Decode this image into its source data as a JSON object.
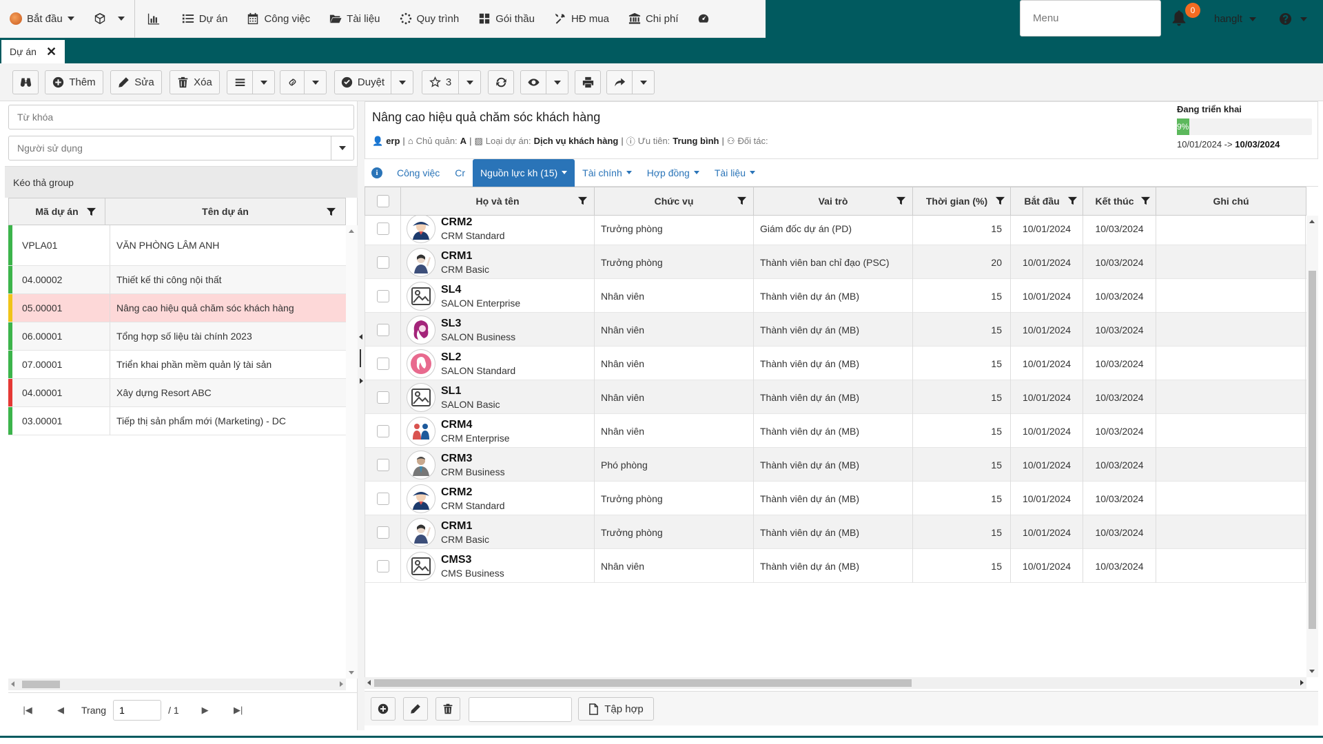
{
  "nav": {
    "start_label": "Bắt đầu",
    "items": [
      {
        "label": "Dự án",
        "icon": "list-icon"
      },
      {
        "label": "Công việc",
        "icon": "calendar-icon"
      },
      {
        "label": "Tài liệu",
        "icon": "folder-icon"
      },
      {
        "label": "Quy trình",
        "icon": "spinner-icon"
      },
      {
        "label": "Gói thầu",
        "icon": "grid-icon"
      },
      {
        "label": "HĐ mua",
        "icon": "tools-icon"
      },
      {
        "label": "Chi phí",
        "icon": "bank-icon"
      }
    ],
    "menu_placeholder": "Menu",
    "notification_count": "0",
    "username": "hanglt",
    "colors": {
      "header": "#015a5f",
      "accent": "#2a74b8",
      "badge": "#f36b21"
    }
  },
  "page_tab": {
    "label": "Dự án",
    "close_icon": "close-icon"
  },
  "toolbar": {
    "add_label": "Thêm",
    "edit_label": "Sửa",
    "delete_label": "Xóa",
    "approve_label": "Duyệt",
    "star_count": "3"
  },
  "left": {
    "keyword_placeholder": "Từ khóa",
    "user_placeholder": "Người sử dụng",
    "group_hint": "Kéo thả group",
    "col_code": "Mã dự án",
    "col_name": "Tên dự án",
    "rows": [
      {
        "code": "VPLA01",
        "name": "VĂN PHÒNG LÂM ANH",
        "status_color": "#3cb44b"
      },
      {
        "code": "04.00002",
        "name": "Thiết kế thi công nội thất",
        "status_color": "#3cb44b"
      },
      {
        "code": "05.00001",
        "name": "Nâng cao hiệu quả chăm sóc khách hàng",
        "status_color": "#f0c419"
      },
      {
        "code": "06.00001",
        "name": "Tổng hợp số liệu tài chính 2023",
        "status_color": "#3cb44b"
      },
      {
        "code": "07.00001",
        "name": "Triển khai phần mềm quản lý tài sản",
        "status_color": "#3cb44b"
      },
      {
        "code": "04.00001",
        "name": "Xây dựng Resort ABC",
        "status_color": "#e53935"
      },
      {
        "code": "03.00001",
        "name": "Tiếp thị sản phẩm mới (Marketing) - DC",
        "status_color": "#3cb44b"
      }
    ],
    "pager": {
      "page_label": "Trang",
      "page_value": "1",
      "total": "/ 1"
    }
  },
  "project": {
    "title": "Nâng cao hiệu quả chăm sóc khách hàng",
    "owner": "erp",
    "manager_label": "Chủ quản:",
    "manager": "A",
    "type_label": "Loại dự án:",
    "type": "Dịch vụ khách hàng",
    "priority_label": "Ưu tiên:",
    "priority": "Trung bình",
    "partner_label": "Đối tác:",
    "status": "Đang triển khai",
    "progress_text": "9%",
    "progress_value": 0.09,
    "date_from": "10/01/2024 ->",
    "date_to": "10/03/2024"
  },
  "tabs": [
    {
      "label": "Công việc",
      "dropdown": false
    },
    {
      "label": "Cr",
      "dropdown": false
    },
    {
      "label": "Nguồn lực kh (15)",
      "dropdown": true,
      "active": true
    },
    {
      "label": "Tài chính",
      "dropdown": true
    },
    {
      "label": "Hợp đồng",
      "dropdown": true
    },
    {
      "label": "Tài liệu",
      "dropdown": true
    }
  ],
  "grid": {
    "headers": {
      "name": "Họ và tên",
      "position": "Chức vụ",
      "role": "Vai trò",
      "time": "Thời gian (%)",
      "start": "Bắt đầu",
      "end": "Kết thúc",
      "note": "Ghi chú"
    },
    "rows": [
      {
        "name": "CRM2",
        "plan": "CRM Standard",
        "position": "Trưởng phòng",
        "role": "Giám đốc dự án (PD)",
        "time": "15",
        "start": "10/01/2024",
        "end": "10/03/2024",
        "avatar": "woman-hat-avatar"
      },
      {
        "name": "CRM1",
        "plan": "CRM Basic",
        "position": "Trưởng phòng",
        "role": "Thành viên ban chỉ đạo (PSC)",
        "time": "20",
        "start": "10/01/2024",
        "end": "10/03/2024",
        "avatar": "woman-wave-avatar"
      },
      {
        "name": "SL4",
        "plan": "SALON Enterprise",
        "position": "Nhân viên",
        "role": "Thành viên dự án (MB)",
        "time": "15",
        "start": "10/01/2024",
        "end": "10/03/2024",
        "avatar": "image-placeholder-avatar"
      },
      {
        "name": "SL3",
        "plan": "SALON Business",
        "position": "Nhân viên",
        "role": "Thành viên dự án (MB)",
        "time": "15",
        "start": "10/01/2024",
        "end": "10/03/2024",
        "avatar": "hair-salon-avatar"
      },
      {
        "name": "SL2",
        "plan": "SALON Standard",
        "position": "Nhân viên",
        "role": "Thành viên dự án (MB)",
        "time": "15",
        "start": "10/01/2024",
        "end": "10/03/2024",
        "avatar": "salon-pink-avatar"
      },
      {
        "name": "SL1",
        "plan": "SALON Basic",
        "position": "Nhân viên",
        "role": "Thành viên dự án (MB)",
        "time": "15",
        "start": "10/01/2024",
        "end": "10/03/2024",
        "avatar": "image-placeholder-avatar"
      },
      {
        "name": "CRM4",
        "plan": "CRM Enterprise",
        "position": "Nhân viên",
        "role": "Thành viên dự án (MB)",
        "time": "15",
        "start": "10/01/2024",
        "end": "10/03/2024",
        "avatar": "people-pair-avatar"
      },
      {
        "name": "CRM3",
        "plan": "CRM Business",
        "position": "Phó phòng",
        "role": "Thành viên dự án (MB)",
        "time": "15",
        "start": "10/01/2024",
        "end": "10/03/2024",
        "avatar": "businessman-avatar"
      },
      {
        "name": "CRM2",
        "plan": "CRM Standard",
        "position": "Trưởng phòng",
        "role": "Thành viên dự án (MB)",
        "time": "15",
        "start": "10/01/2024",
        "end": "10/03/2024",
        "avatar": "woman-hat-avatar"
      },
      {
        "name": "CRM1",
        "plan": "CRM Basic",
        "position": "Trưởng phòng",
        "role": "Thành viên dự án (MB)",
        "time": "15",
        "start": "10/01/2024",
        "end": "10/03/2024",
        "avatar": "woman-wave-avatar"
      },
      {
        "name": "CMS3",
        "plan": "CMS Business",
        "position": "Nhân viên",
        "role": "Thành viên dự án (MB)",
        "time": "15",
        "start": "10/01/2024",
        "end": "10/03/2024",
        "avatar": "image-placeholder-avatar"
      }
    ]
  },
  "bottom": {
    "collection_label": "Tập hợp"
  }
}
